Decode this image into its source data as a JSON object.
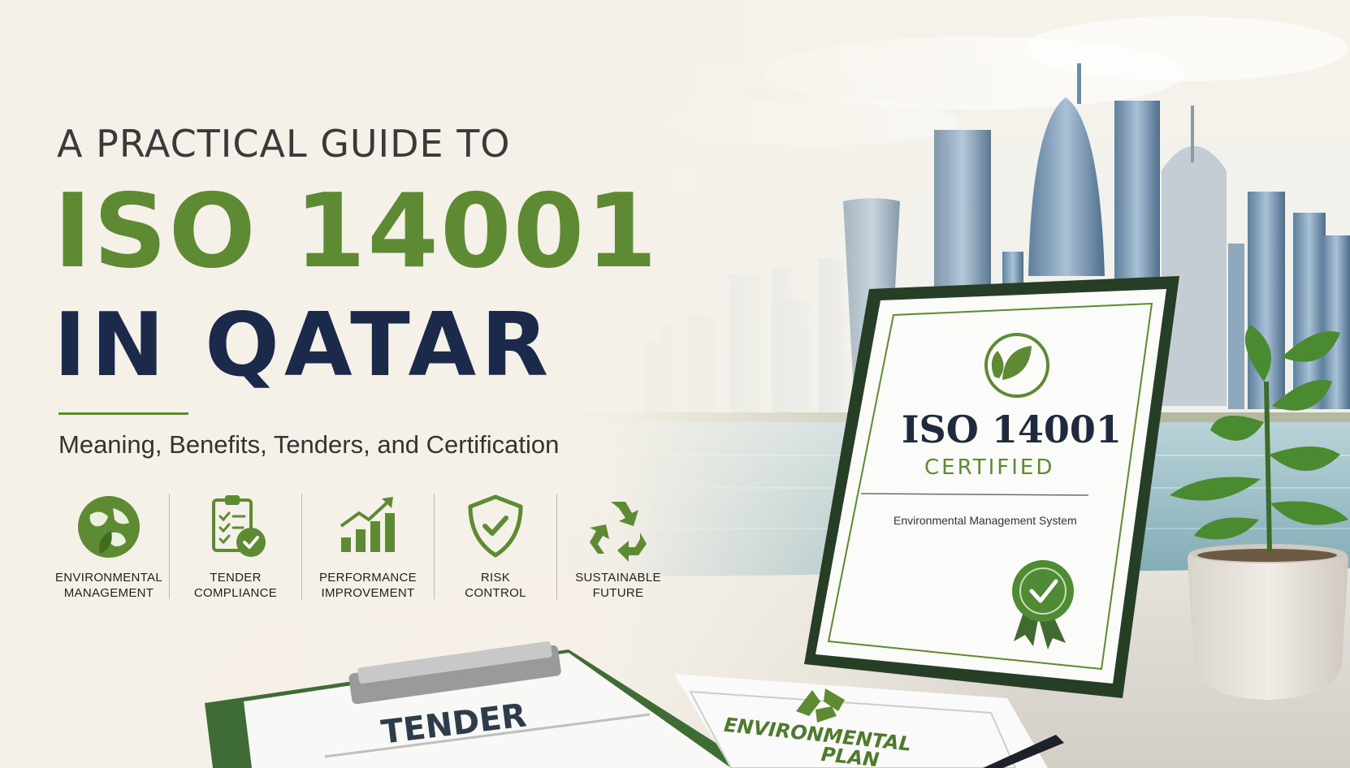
{
  "hero": {
    "kicker": "A PRACTICAL GUIDE TO",
    "title_line1": "ISO 14001",
    "title_line2": "IN QATAR",
    "subtitle": "Meaning, Benefits, Tenders, and Certification"
  },
  "features": [
    {
      "icon": "globe-leaf-icon",
      "line1": "ENVIRONMENTAL",
      "line2": "MANAGEMENT"
    },
    {
      "icon": "clipboard-check-icon",
      "line1": "TENDER",
      "line2": "COMPLIANCE"
    },
    {
      "icon": "growth-chart-icon",
      "line1": "PERFORMANCE",
      "line2": "IMPROVEMENT"
    },
    {
      "icon": "shield-check-icon",
      "line1": "RISK",
      "line2": "CONTROL"
    },
    {
      "icon": "recycle-icon",
      "line1": "SUSTAINABLE",
      "line2": "FUTURE"
    }
  ],
  "certificate": {
    "title": "ISO 14001",
    "subtitle": "CERTIFIED",
    "caption": "Environmental Management System"
  },
  "documents": {
    "tender_label": "TENDER",
    "plan_line1": "ENVIRONMENTAL",
    "plan_line2": "PLAN"
  },
  "colors": {
    "accent_green": "#5d8a32",
    "navy": "#1b2a4a",
    "frame": "#243a24",
    "background": "#f4efe6"
  }
}
